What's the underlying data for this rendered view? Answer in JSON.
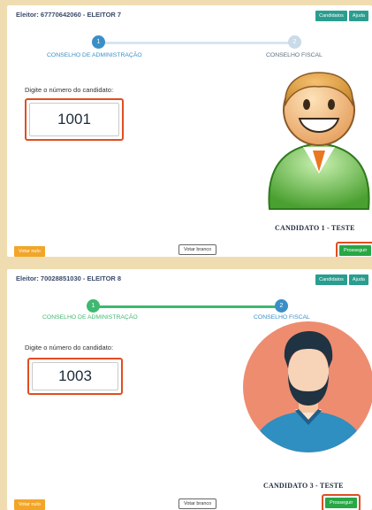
{
  "screens": [
    {
      "voter": "Eleitor: 67770642060 - ELEITOR 7",
      "buttons": {
        "candidates": "Candidatos",
        "help": "Ajuda",
        "null_vote": "Votar nulo",
        "blank_vote": "Votar branco",
        "proceed": "Prosseguir"
      },
      "steps": [
        {
          "number": "1",
          "label": "CONSELHO DE ADMINISTRAÇÃO",
          "state": "active"
        },
        {
          "number": "2",
          "label": "CONSELHO FISCAL",
          "state": "pending"
        }
      ],
      "prompt": "Digite o número do candidato:",
      "candidate_number": "1001",
      "candidate_name": "CANDIDATO 1 - TESTE",
      "avatar": "cartoon-man-avatar-icon"
    },
    {
      "voter": "Eleitor: 70028851030 - ELEITOR 8",
      "buttons": {
        "candidates": "Candidatos",
        "help": "Ajuda",
        "null_vote": "Votar nulo",
        "blank_vote": "Votar branco",
        "proceed": "Prosseguir"
      },
      "steps": [
        {
          "number": "1",
          "label": "CONSELHO DE ADMINISTRAÇÃO",
          "state": "done"
        },
        {
          "number": "2",
          "label": "CONSELHO FISCAL",
          "state": "active"
        }
      ],
      "prompt": "Digite o número do candidato:",
      "candidate_number": "1003",
      "candidate_name": "CANDIDATO 3 - TESTE",
      "avatar": "bearded-man-avatar-icon"
    }
  ],
  "colors": {
    "background": "#efdcb0",
    "primary_blue": "#3a8fc7",
    "success_green": "#28a745",
    "warning_orange": "#f2a527",
    "teal": "#2a9d8f",
    "highlight_red": "#e04e22"
  }
}
